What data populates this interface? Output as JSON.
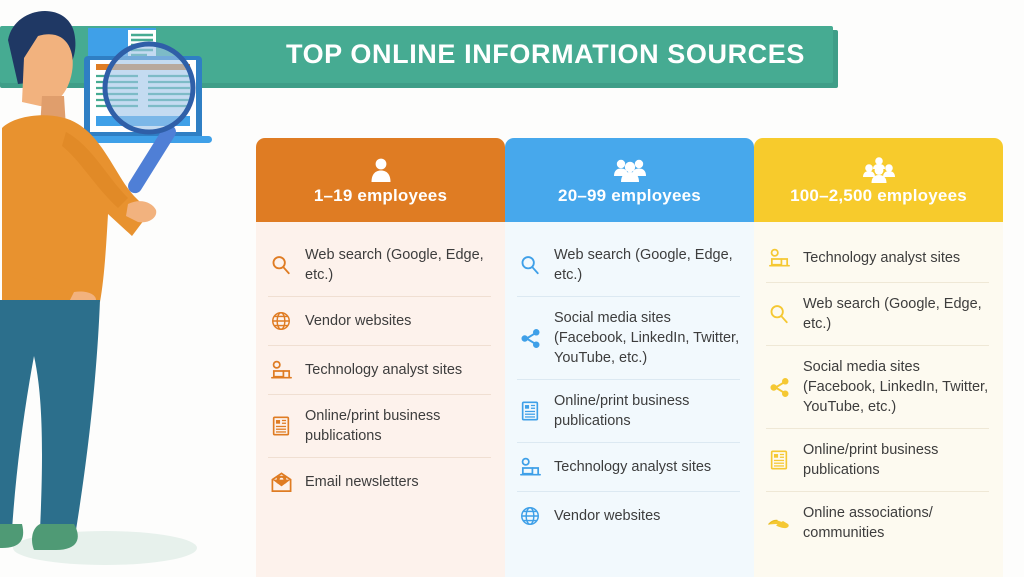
{
  "banner": {
    "title": "TOP ONLINE INFORMATION SOURCES",
    "color": "#46ab92",
    "shadow_color": "#3f9e88",
    "title_color": "#ffffff"
  },
  "illustration": {
    "name": "person-with-magnifying-glass-and-laptop",
    "hair_color": "#1f3864",
    "skin_color": "#f2b27e",
    "sweater_color": "#e8922f",
    "pants_color": "#2c6f8c",
    "shoe_color": "#4f9a75",
    "laptop_color": "#3fa0e8",
    "lens_color": "#9fc5e8"
  },
  "columns": [
    {
      "key": "small",
      "header_label": "1–19 employees",
      "header_color": "#df7c23",
      "header_icon": "single-person-icon",
      "body_color": "#fdf2ec",
      "icon_color": "#df7c23",
      "divider_color": "#f0dfd2",
      "items": [
        {
          "icon": "search-icon",
          "label": "Web search (Google, Edge, etc.)"
        },
        {
          "icon": "globe-www-icon",
          "label": "Vendor websites"
        },
        {
          "icon": "analyst-laptop-icon",
          "label": "Technology analyst sites"
        },
        {
          "icon": "publication-icon",
          "label": "Online/print business publications"
        },
        {
          "icon": "email-newsletter-icon",
          "label": "Email newsletters"
        }
      ]
    },
    {
      "key": "medium",
      "header_label": "20–99 employees",
      "header_color": "#47a8ec",
      "header_icon": "three-person-group-icon",
      "body_color": "#f2f9fd",
      "icon_color": "#3fa0e8",
      "divider_color": "#dce9f2",
      "items": [
        {
          "icon": "search-icon",
          "label": "Web search (Google, Edge, etc.)"
        },
        {
          "icon": "social-share-icon",
          "label": "Social media sites (Facebook, LinkedIn, Twitter, YouTube, etc.)"
        },
        {
          "icon": "publication-icon",
          "label": "Online/print business publications"
        },
        {
          "icon": "analyst-laptop-icon",
          "label": "Technology analyst sites"
        },
        {
          "icon": "globe-www-icon",
          "label": "Vendor websites"
        }
      ]
    },
    {
      "key": "large",
      "header_label": "100–2,500 employees",
      "header_color": "#f7cb2c",
      "header_icon": "large-group-icon",
      "body_color": "#fdfaf0",
      "icon_color": "#f5c833",
      "divider_color": "#efe8d6",
      "items": [
        {
          "icon": "analyst-laptop-icon",
          "label": "Technology analyst sites"
        },
        {
          "icon": "search-icon",
          "label": "Web search (Google, Edge, etc.)"
        },
        {
          "icon": "social-share-icon",
          "label": "Social media sites (Facebook, LinkedIn, Twitter, YouTube, etc.)"
        },
        {
          "icon": "publication-icon",
          "label": "Online/print business publications"
        },
        {
          "icon": "handshake-icon",
          "label": "Online associations/ communities"
        }
      ]
    }
  ]
}
